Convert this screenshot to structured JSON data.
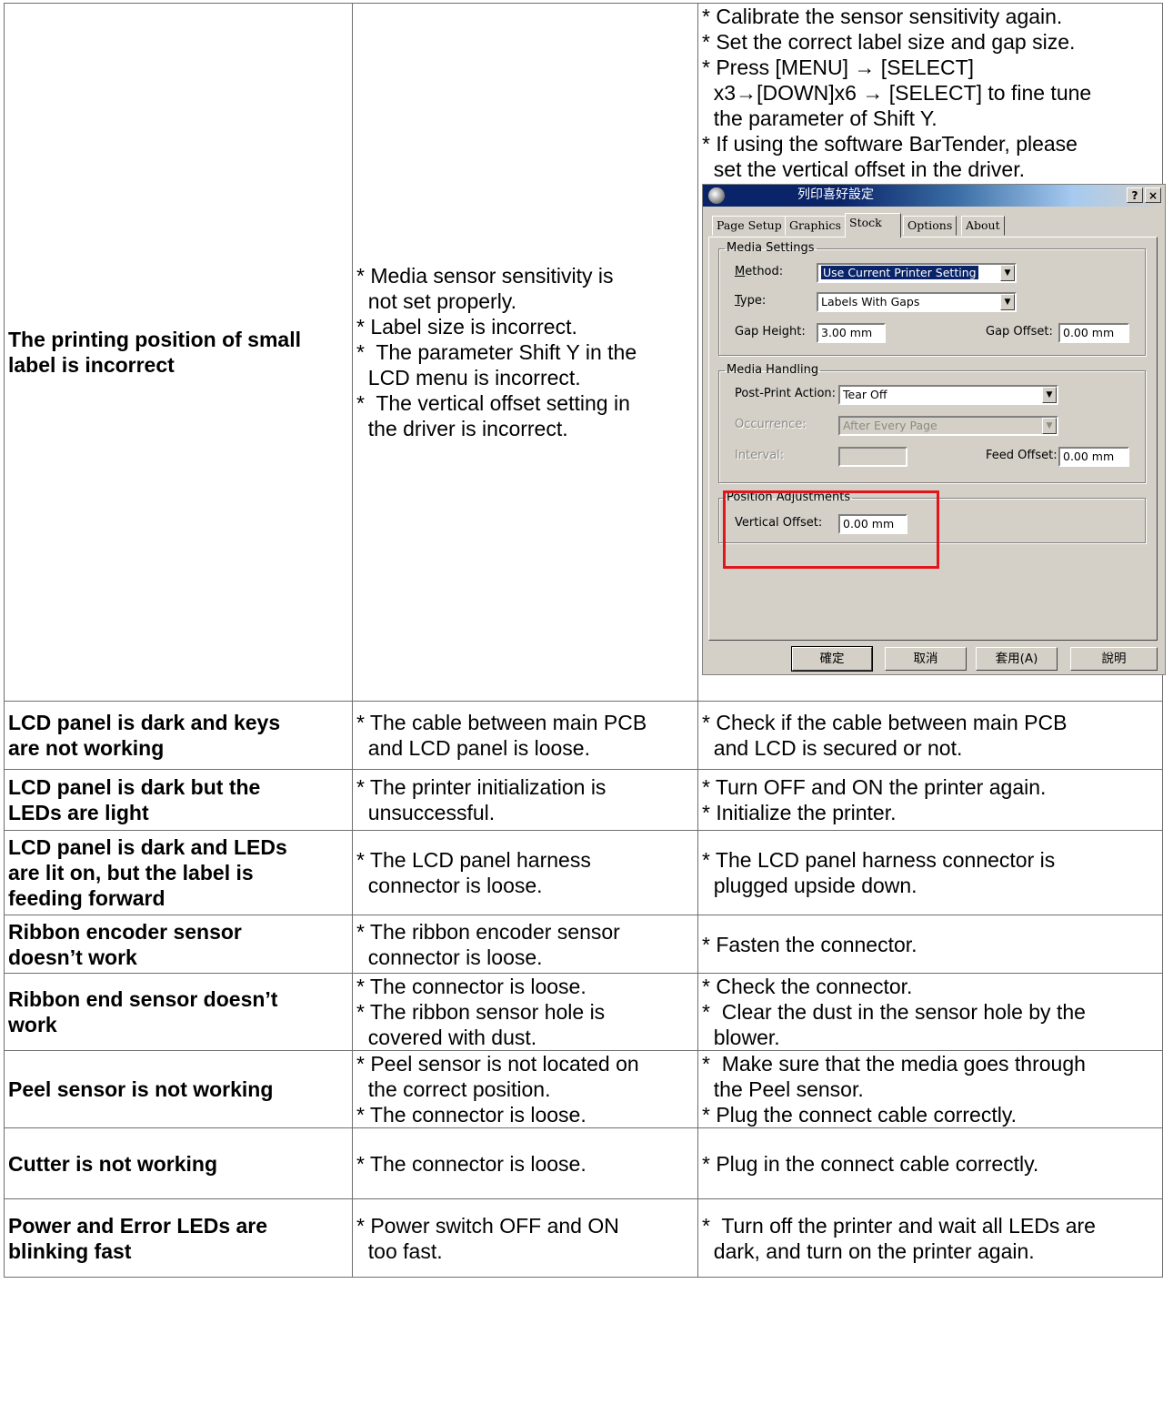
{
  "rows": [
    {
      "problem": [
        "The printing position of small",
        "label is incorrect"
      ],
      "causes": [
        "* Media sensor sensitivity is",
        "  not set properly.",
        "* Label size is incorrect.",
        "*  The parameter Shift Y in the",
        "  LCD menu is incorrect.",
        "*  The vertical offset setting in",
        "  the driver is incorrect."
      ],
      "solutions": [
        "* Calibrate the sensor sensitivity again.",
        "* Set the correct label size and gap size.",
        "* Press [MENU] → [SELECT]",
        "  x3→[DOWN]x6 → [SELECT] to fine tune",
        "  the parameter of Shift Y.",
        "* If using the software BarTender, please",
        "  set the vertical offset in the driver."
      ]
    },
    {
      "problem": [
        "LCD panel is dark and keys",
        "are not working"
      ],
      "causes": [
        "* The cable between main PCB",
        "  and LCD panel is loose."
      ],
      "solutions": [
        "* Check if the cable between main PCB",
        "  and LCD is secured or not."
      ]
    },
    {
      "problem": [
        "LCD panel is dark but the",
        "LEDs are light"
      ],
      "causes": [
        "* The printer initialization is",
        "  unsuccessful."
      ],
      "solutions": [
        "* Turn OFF and ON the printer again.",
        "* Initialize the printer."
      ]
    },
    {
      "problem": [
        "LCD panel is dark and LEDs",
        "are lit on, but the label is",
        "feeding forward"
      ],
      "causes": [
        "* The LCD panel harness",
        "  connector is loose."
      ],
      "solutions": [
        "* The LCD panel harness connector is",
        "  plugged upside down."
      ]
    },
    {
      "problem": [
        "Ribbon encoder sensor",
        "doesn’t work"
      ],
      "causes": [
        "* The ribbon encoder sensor",
        "  connector is loose."
      ],
      "solutions": [
        "* Fasten the connector."
      ]
    },
    {
      "problem": [
        "Ribbon end sensor doesn’t",
        "work"
      ],
      "causes": [
        "* The connector is loose.",
        "* The ribbon sensor hole is",
        "  covered with dust."
      ],
      "solutions": [
        "* Check the connector.",
        "*  Clear the dust in the sensor hole by the",
        "  blower."
      ]
    },
    {
      "problem": [
        "Peel sensor is not working"
      ],
      "causes": [
        "* Peel sensor is not located on",
        "  the correct position.",
        "* The connector is loose."
      ],
      "solutions": [
        "*  Make sure that the media goes through",
        "  the Peel sensor.",
        "* Plug the connect cable correctly."
      ]
    },
    {
      "problem": [
        "Cutter is not working"
      ],
      "causes": [
        "* The connector is loose."
      ],
      "solutions": [
        "* Plug in the connect cable correctly."
      ]
    },
    {
      "problem": [
        "Power and Error LEDs are",
        "blinking fast"
      ],
      "causes": [
        "* Power switch OFF and ON",
        "  too fast."
      ],
      "solutions": [
        "*  Turn off the printer and wait all LEDs are",
        "  dark, and turn on the printer again."
      ]
    }
  ],
  "dialog": {
    "title": "列印喜好設定",
    "help_btn": "?",
    "close_btn": "×",
    "tabs": [
      "Page Setup",
      "Graphics",
      "Stock",
      "Options",
      "About"
    ],
    "active_tab": "Stock",
    "media_settings": {
      "legend": "Media Settings",
      "method_label": "Method:",
      "method_value": "Use Current Printer Setting",
      "type_label": "Type:",
      "type_value": "Labels With Gaps",
      "gap_height_label": "Gap Height:",
      "gap_height_value": "3.00 mm",
      "gap_offset_label": "Gap Offset:",
      "gap_offset_value": "0.00 mm"
    },
    "media_handling": {
      "legend": "Media Handling",
      "post_print_label": "Post-Print Action:",
      "post_print_value": "Tear Off",
      "occurrence_label": "Occurrence:",
      "occurrence_value": "After Every Page",
      "interval_label": "Interval:",
      "interval_value": "",
      "feed_offset_label": "Feed Offset:",
      "feed_offset_value": "0.00 mm"
    },
    "position_adjustments": {
      "legend": "Position Adjustments",
      "vertical_offset_label": "Vertical Offset:",
      "vertical_offset_value": "0.00 mm"
    },
    "buttons": {
      "ok": "確定",
      "cancel": "取消",
      "apply": "套用(A)",
      "help": "說明"
    }
  }
}
